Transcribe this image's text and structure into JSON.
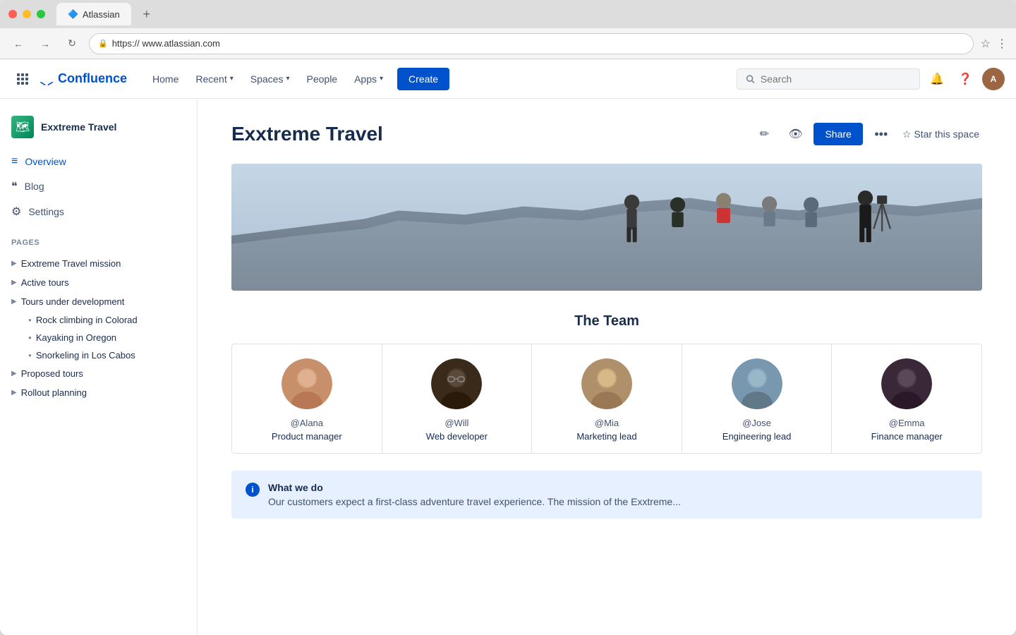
{
  "browser": {
    "tab_title": "Atlassian",
    "url": "https:// www.atlassian.com",
    "new_tab_icon": "+",
    "back_icon": "←",
    "forward_icon": "→",
    "reload_icon": "↻"
  },
  "nav": {
    "logo_text": "Confluence",
    "home_label": "Home",
    "recent_label": "Recent",
    "spaces_label": "Spaces",
    "people_label": "People",
    "apps_label": "Apps",
    "create_label": "Create",
    "search_placeholder": "Search"
  },
  "sidebar": {
    "space_name": "Exxtreme Travel",
    "overview_label": "Overview",
    "blog_label": "Blog",
    "settings_label": "Settings",
    "pages_section_label": "PAGES",
    "pages": [
      {
        "label": "Exxtreme Travel mission",
        "level": 1
      },
      {
        "label": "Active tours",
        "level": 1
      },
      {
        "label": "Tours under development",
        "level": 1
      },
      {
        "label": "Rock climbing in Colorad",
        "level": 2
      },
      {
        "label": "Kayaking in Oregon",
        "level": 2
      },
      {
        "label": "Snorkeling in Los Cabos",
        "level": 2
      },
      {
        "label": "Proposed tours",
        "level": 1
      },
      {
        "label": "Rollout planning",
        "level": 1
      }
    ]
  },
  "page": {
    "title": "Exxtreme Travel",
    "share_label": "Share",
    "star_label": "Star this space",
    "more_label": "...",
    "team_title": "The Team",
    "team_members": [
      {
        "handle": "@Alana",
        "role": "Product manager",
        "color": "alana"
      },
      {
        "handle": "@Will",
        "role": "Web developer",
        "color": "will"
      },
      {
        "handle": "@Mia",
        "role": "Marketing lead",
        "color": "mia"
      },
      {
        "handle": "@Jose",
        "role": "Engineering lead",
        "color": "jose"
      },
      {
        "handle": "@Emma",
        "role": "Finance manager",
        "color": "emma"
      }
    ],
    "info_box": {
      "title": "What we do",
      "text": "Our customers expect a first-class adventure travel experience. The mission of the Exxtreme..."
    }
  }
}
